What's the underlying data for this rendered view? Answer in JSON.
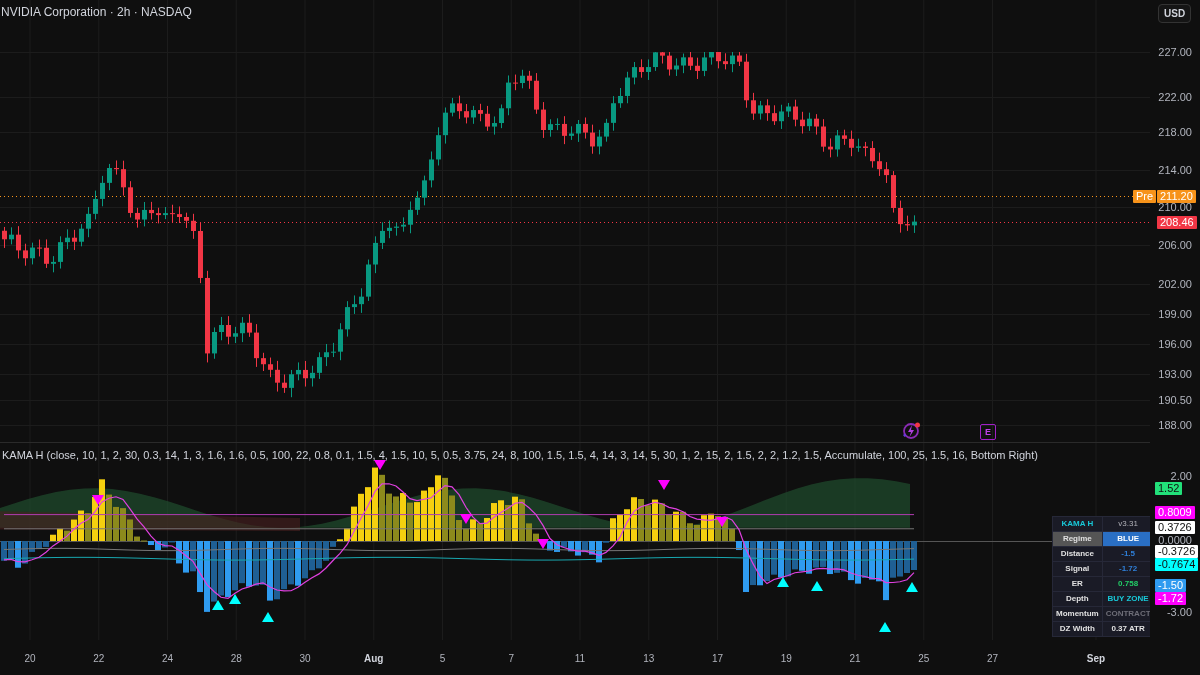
{
  "header": {
    "title": "NVIDIA Corporation · 2h · NASDAQ"
  },
  "currency_button": "USD",
  "price_axis": {
    "ticks": [
      "227.00",
      "222.00",
      "218.00",
      "214.00",
      "210.00",
      "206.00",
      "202.00",
      "199.00",
      "196.00",
      "193.00",
      "190.50",
      "188.00"
    ],
    "premarket": {
      "label": "Pre",
      "price": "211.20"
    },
    "last_price": "208.46"
  },
  "event_icons": [
    {
      "kind": "lightning"
    },
    {
      "kind": "earnings",
      "label": "E"
    }
  ],
  "indicator": {
    "legend": "KAMA H (close, 10, 1, 2, 30, 0.3, 14, 1, 3, 1.6, 1.6, 0.5, 100, 22, 0.8, 0.1, 1.5, 4, 1.5, 10, 5, 0.5, 3.75, 24, 8, 100, 1.5, 1.5, 4, 14, 3, 14, 5, 30, 1, 2, 15, 2, 1.5, 2, 2, 1.2, 1.5, Accumulate, 100, 25, 1.5, 16, Bottom Right)",
    "axis_ticks": [
      "2.00",
      "0.0000",
      "-3.00"
    ],
    "badges": [
      {
        "text": "1.52",
        "color": "#22e07a"
      },
      {
        "text": "0.8009",
        "color": "#ff00ff"
      },
      {
        "text": "0.3726",
        "color": "#ffffff"
      },
      {
        "text": "-0.3726",
        "color": "#ffffff"
      },
      {
        "text": "-0.7674",
        "color": "#00ffff"
      },
      {
        "text": "-1.50",
        "color": "#2f9bf0"
      },
      {
        "text": "-1.72",
        "color": "#ff00ff"
      }
    ],
    "table": {
      "header": {
        "label": "KAMA H",
        "value": "v3.31"
      },
      "rows": [
        {
          "label": "Regime",
          "value": "BLUE",
          "highlighted": true
        },
        {
          "label": "Distance",
          "value": "-1.5",
          "color": "#2f7fd8",
          "highlighted": false
        },
        {
          "label": "Signal",
          "value": "-1.72",
          "color": "#2f7fd8",
          "highlighted": false
        },
        {
          "label": "ER",
          "value": "0.758",
          "color": "#22cc66",
          "highlighted": false
        },
        {
          "label": "Depth",
          "value": "BUY ZONE",
          "color": "#18c8d8",
          "highlighted": false
        },
        {
          "label": "Momentum",
          "value": "CONTRACT",
          "color": "#6e6e78",
          "highlighted": false
        },
        {
          "label": "DZ Width",
          "value": "0.37 ATR",
          "color": "#e0e0e0",
          "highlighted": false
        }
      ]
    }
  },
  "time_axis": [
    {
      "label": "20",
      "kind": "day"
    },
    {
      "label": "22",
      "kind": "day"
    },
    {
      "label": "24",
      "kind": "day"
    },
    {
      "label": "28",
      "kind": "day"
    },
    {
      "label": "30",
      "kind": "day"
    },
    {
      "label": "Aug",
      "kind": "month"
    },
    {
      "label": "5",
      "kind": "day"
    },
    {
      "label": "7",
      "kind": "day"
    },
    {
      "label": "11",
      "kind": "day"
    },
    {
      "label": "13",
      "kind": "day"
    },
    {
      "label": "17",
      "kind": "day"
    },
    {
      "label": "19",
      "kind": "day"
    },
    {
      "label": "21",
      "kind": "day"
    },
    {
      "label": "25",
      "kind": "day"
    },
    {
      "label": "27",
      "kind": "day"
    },
    {
      "label": "Sep",
      "kind": "month"
    }
  ]
}
